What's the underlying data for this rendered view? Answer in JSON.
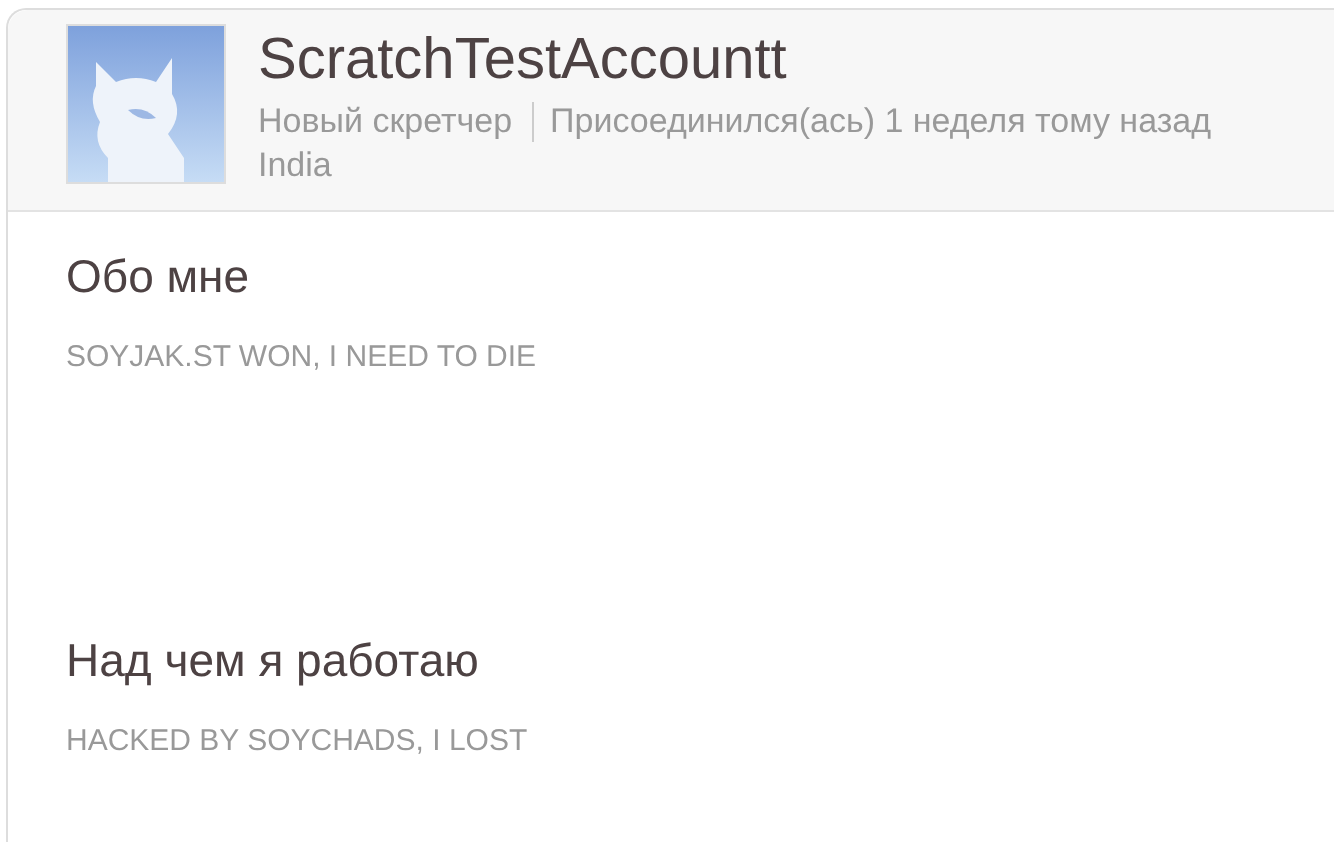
{
  "profile": {
    "username": "ScratchTestAccountt",
    "status": "Новый скретчер",
    "joined": "Присоединился(ась) 1 неделя тому назад",
    "location": "India"
  },
  "sections": [
    {
      "heading": "Обо мне",
      "text": "SOYJAK.ST WON, I NEED TO DIE"
    },
    {
      "heading": "Над чем я работаю",
      "text": "HACKED BY SOYCHADS, I LOST"
    }
  ]
}
